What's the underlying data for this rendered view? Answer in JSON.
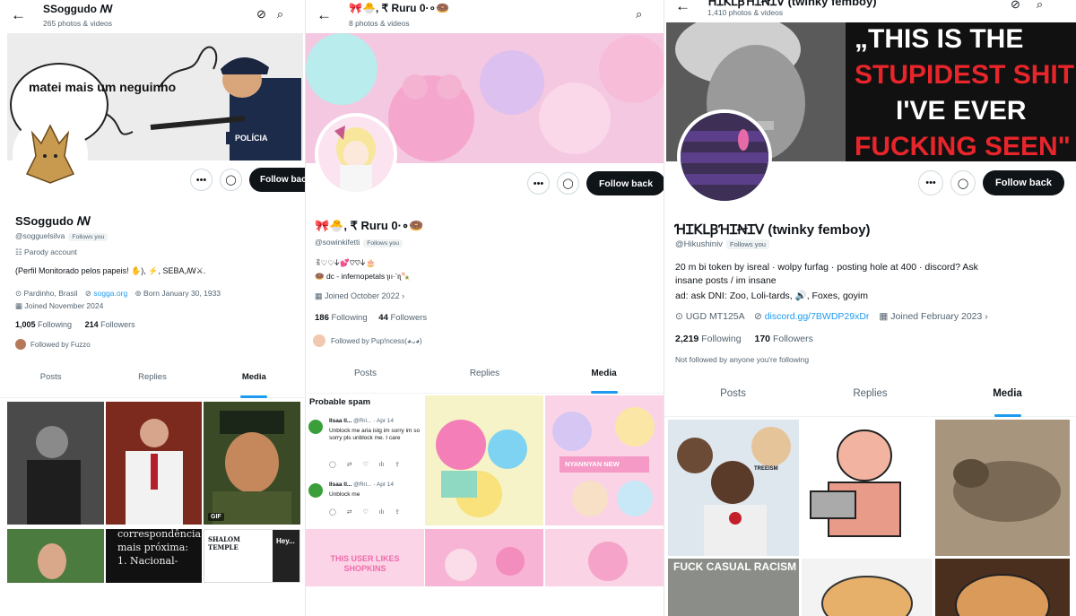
{
  "panel1": {
    "top": {
      "name": "SSoggudo ꟿ",
      "count": "265 photos & videos"
    },
    "banner": {
      "speech": "matei mais um neguinho",
      "sign": "POLÍCIA"
    },
    "profile": {
      "name": "SSoggudo ꟿ",
      "handle": "@sogguelsilva",
      "follows_you": "Follows you",
      "parody": "Parody account",
      "bio": "(Perfil Monitorado pelos papeis! ✋), ⚡, SEBA,ꟿ⚔.",
      "location": "Pardinho, Brasil",
      "website": "sogga.org",
      "born": "Born January 30, 1933",
      "joined": "Joined November 2024",
      "following_count": "1,005",
      "following_label": "Following",
      "followers_count": "214",
      "followers_label": "Followers",
      "followed_by": "Followed by Fuzzo"
    },
    "follow_back": "Follow back",
    "tabs": [
      "Posts",
      "Replies",
      "Media"
    ],
    "media": {
      "gif": "GIF",
      "text1": "correspondência mais próxima: 1. Nacional-",
      "shalom": "SHALOM TEMPLE",
      "hey": "Hey..."
    }
  },
  "panel2": {
    "top": {
      "name": "🎀🐣, ₹ Ruru 0·∘🍩",
      "count": "8 photos & videos"
    },
    "profile": {
      "name": "🎀🐣, ₹ Ruru 0·∘🍩",
      "handle": "@sowinkifetti",
      "follows_you": "Follows you",
      "bio1": "ꉂ♡♡𐊜💕♡♡𐊜🎂",
      "bio2": "🍩 dc - infernopetals ʅıı·ʼıʅ🍡",
      "joined": "Joined October 2022",
      "following_count": "186",
      "following_label": "Following",
      "followers_count": "44",
      "followers_label": "Followers",
      "followed_by": "Followed by Pup!ncess(◕ᴗ◕)"
    },
    "follow_back": "Follow back",
    "tabs": [
      "Posts",
      "Replies",
      "Media"
    ],
    "spam": {
      "title": "Probable spam",
      "items": [
        {
          "name": "Ilsaa ll...",
          "handle": "@Rri...",
          "date": "Apr 14",
          "text": "Unblock me aria istg im sorry im so sorry pls unblock me. I care"
        },
        {
          "name": "Ilsaa ll...",
          "handle": "@Rri...",
          "date": "Apr 14",
          "text": "Unblock me"
        }
      ]
    },
    "media": {
      "nyan": "NYANNYAN NEW",
      "likes": "THIS USER LIKES SHOPKINS"
    }
  },
  "panel3": {
    "top": {
      "name": "ꞪꞮꓗꓡꞴꞪꞮꞤꞮꓦ (twinky femboy)",
      "count": "1,410 photos & videos"
    },
    "banner": {
      "l1": "„THIS IS THE",
      "l2": "STUPIDEST SHIT",
      "l3": "I'VE EVER",
      "l4": "FUCKING SEEN\""
    },
    "profile": {
      "name": "ꞪꞮꓗꓡꞴꞪꞮꞤꞮꓦ (twinky femboy)",
      "handle": "@Hikushiniv",
      "follows_you": "Follows you",
      "bio1": "20 m bi token by isreal · wolpy furfag · posting hole at 400 · discord? Ask",
      "bio2": "insane posts / im insane",
      "bio3": "ad: ask DNI: Zoo, Loli-tards, 🔊, Foxes, goyim",
      "location": "UGD MT125A",
      "website": "discord.gg/7BWDP29xDr",
      "joined": "Joined February 2023",
      "following_count": "2,219",
      "following_label": "Following",
      "followers_count": "170",
      "followers_label": "Followers",
      "not_followed": "Not followed by anyone you're following"
    },
    "follow_back": "Follow back",
    "tabs": [
      "Posts",
      "Replies",
      "Media"
    ],
    "media": {
      "racism": "FUCK CASUAL RACISM",
      "tree": "TREEISM"
    }
  },
  "icons": {
    "back": "back-arrow-icon",
    "search": "search-icon",
    "more": "more-icon",
    "message": "message-icon"
  }
}
